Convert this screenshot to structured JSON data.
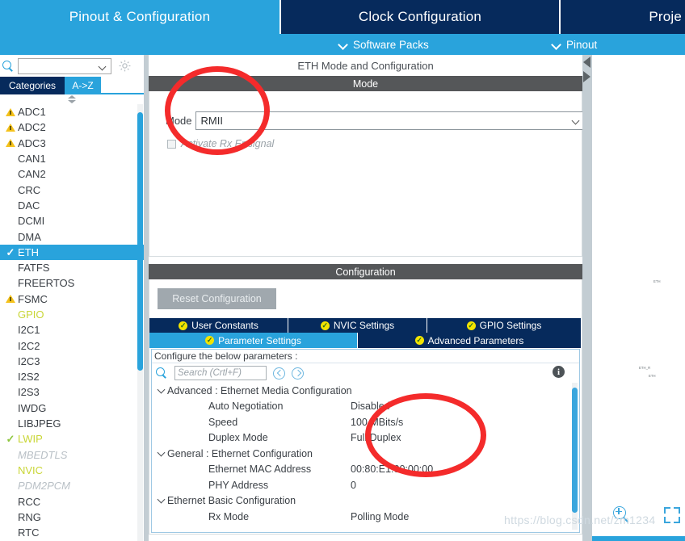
{
  "topnav": {
    "tabs": [
      {
        "label": "Pinout & Configuration",
        "state": "active"
      },
      {
        "label": "Clock Configuration",
        "state": "inactive"
      },
      {
        "label": "Proje",
        "state": "inactive"
      }
    ]
  },
  "subnav": {
    "software_packs": "Software Packs",
    "pinout": "Pinout"
  },
  "sidebar": {
    "search_value": "",
    "tabs": {
      "categories": "Categories",
      "az": "A->Z"
    },
    "items": [
      {
        "label": "ADC1",
        "icon": "warning-triangle-icon",
        "style": "normal"
      },
      {
        "label": "ADC2",
        "icon": "warning-triangle-icon",
        "style": "normal"
      },
      {
        "label": "ADC3",
        "icon": "warning-triangle-icon",
        "style": "normal"
      },
      {
        "label": "CAN1",
        "icon": "none",
        "style": "normal"
      },
      {
        "label": "CAN2",
        "icon": "none",
        "style": "normal"
      },
      {
        "label": "CRC",
        "icon": "none",
        "style": "normal"
      },
      {
        "label": "DAC",
        "icon": "none",
        "style": "normal"
      },
      {
        "label": "DCMI",
        "icon": "none",
        "style": "normal"
      },
      {
        "label": "DMA",
        "icon": "none",
        "style": "normal"
      },
      {
        "label": "ETH",
        "icon": "check-icon",
        "style": "selected"
      },
      {
        "label": "FATFS",
        "icon": "none",
        "style": "normal"
      },
      {
        "label": "FREERTOS",
        "icon": "none",
        "style": "normal"
      },
      {
        "label": "FSMC",
        "icon": "warning-triangle-icon",
        "style": "normal"
      },
      {
        "label": "GPIO",
        "icon": "none",
        "style": "green"
      },
      {
        "label": "I2C1",
        "icon": "none",
        "style": "normal"
      },
      {
        "label": "I2C2",
        "icon": "none",
        "style": "normal"
      },
      {
        "label": "I2C3",
        "icon": "none",
        "style": "normal"
      },
      {
        "label": "I2S2",
        "icon": "none",
        "style": "normal"
      },
      {
        "label": "I2S3",
        "icon": "none",
        "style": "normal"
      },
      {
        "label": "IWDG",
        "icon": "none",
        "style": "normal"
      },
      {
        "label": "LIBJPEG",
        "icon": "none",
        "style": "normal"
      },
      {
        "label": "LWIP",
        "icon": "check-icon",
        "style": "green"
      },
      {
        "label": "MBEDTLS",
        "icon": "none",
        "style": "disabled"
      },
      {
        "label": "NVIC",
        "icon": "none",
        "style": "green"
      },
      {
        "label": "PDM2PCM",
        "icon": "none",
        "style": "disabled"
      },
      {
        "label": "RCC",
        "icon": "none",
        "style": "normal"
      },
      {
        "label": "RNG",
        "icon": "none",
        "style": "normal"
      },
      {
        "label": "RTC",
        "icon": "none",
        "style": "normal"
      }
    ]
  },
  "main": {
    "panel_title": "ETH Mode and Configuration",
    "mode_band": "Mode",
    "mode_label": "Mode",
    "mode_value": "RMII",
    "rx_er_checkbox_label": "Activate Rx Er signal",
    "rx_er_checked": false,
    "configuration_band": "Configuration",
    "reset_button": "Reset Configuration",
    "tabs_row1": [
      {
        "label": "User Constants",
        "selected": false
      },
      {
        "label": "NVIC Settings",
        "selected": false
      },
      {
        "label": "GPIO Settings",
        "selected": false
      }
    ],
    "tabs_row2": [
      {
        "label": "Parameter Settings",
        "selected": true
      },
      {
        "label": "Advanced Parameters",
        "selected": false
      }
    ],
    "configure_hint": "Configure the below parameters :",
    "search_placeholder": "Search (Crtl+F)",
    "search_value": "",
    "parameters": [
      {
        "type": "group",
        "name": "Advanced : Ethernet Media Configuration",
        "value": ""
      },
      {
        "type": "item",
        "name": "Auto Negotiation",
        "value": "Disabled"
      },
      {
        "type": "item",
        "name": "Speed",
        "value": "100 MBits/s"
      },
      {
        "type": "item",
        "name": "Duplex Mode",
        "value": "Full Duplex"
      },
      {
        "type": "group",
        "name": "General : Ethernet Configuration",
        "value": ""
      },
      {
        "type": "item",
        "name": "Ethernet MAC Address",
        "value": "00:80:E1:00:00:00"
      },
      {
        "type": "item",
        "name": "PHY Address",
        "value": "0"
      },
      {
        "type": "group",
        "name": "Ethernet Basic Configuration",
        "value": ""
      },
      {
        "type": "item",
        "name": "Rx Mode",
        "value": "Polling Mode"
      }
    ]
  },
  "right_pane": {
    "pin_labels": [
      "ETH",
      "ETH_R",
      "ETH"
    ],
    "zoom_in_icon": "zoom-in-icon",
    "fit_icon": "fit-to-screen-icon"
  },
  "watermark": "https://blog.csdn.net/zm1234",
  "colors": {
    "brand_blue": "#29a3dc",
    "dark_navy": "#062a5c",
    "band_gray": "#555759",
    "accent_green": "#c9d636",
    "annotation_red": "#f42b2b"
  }
}
